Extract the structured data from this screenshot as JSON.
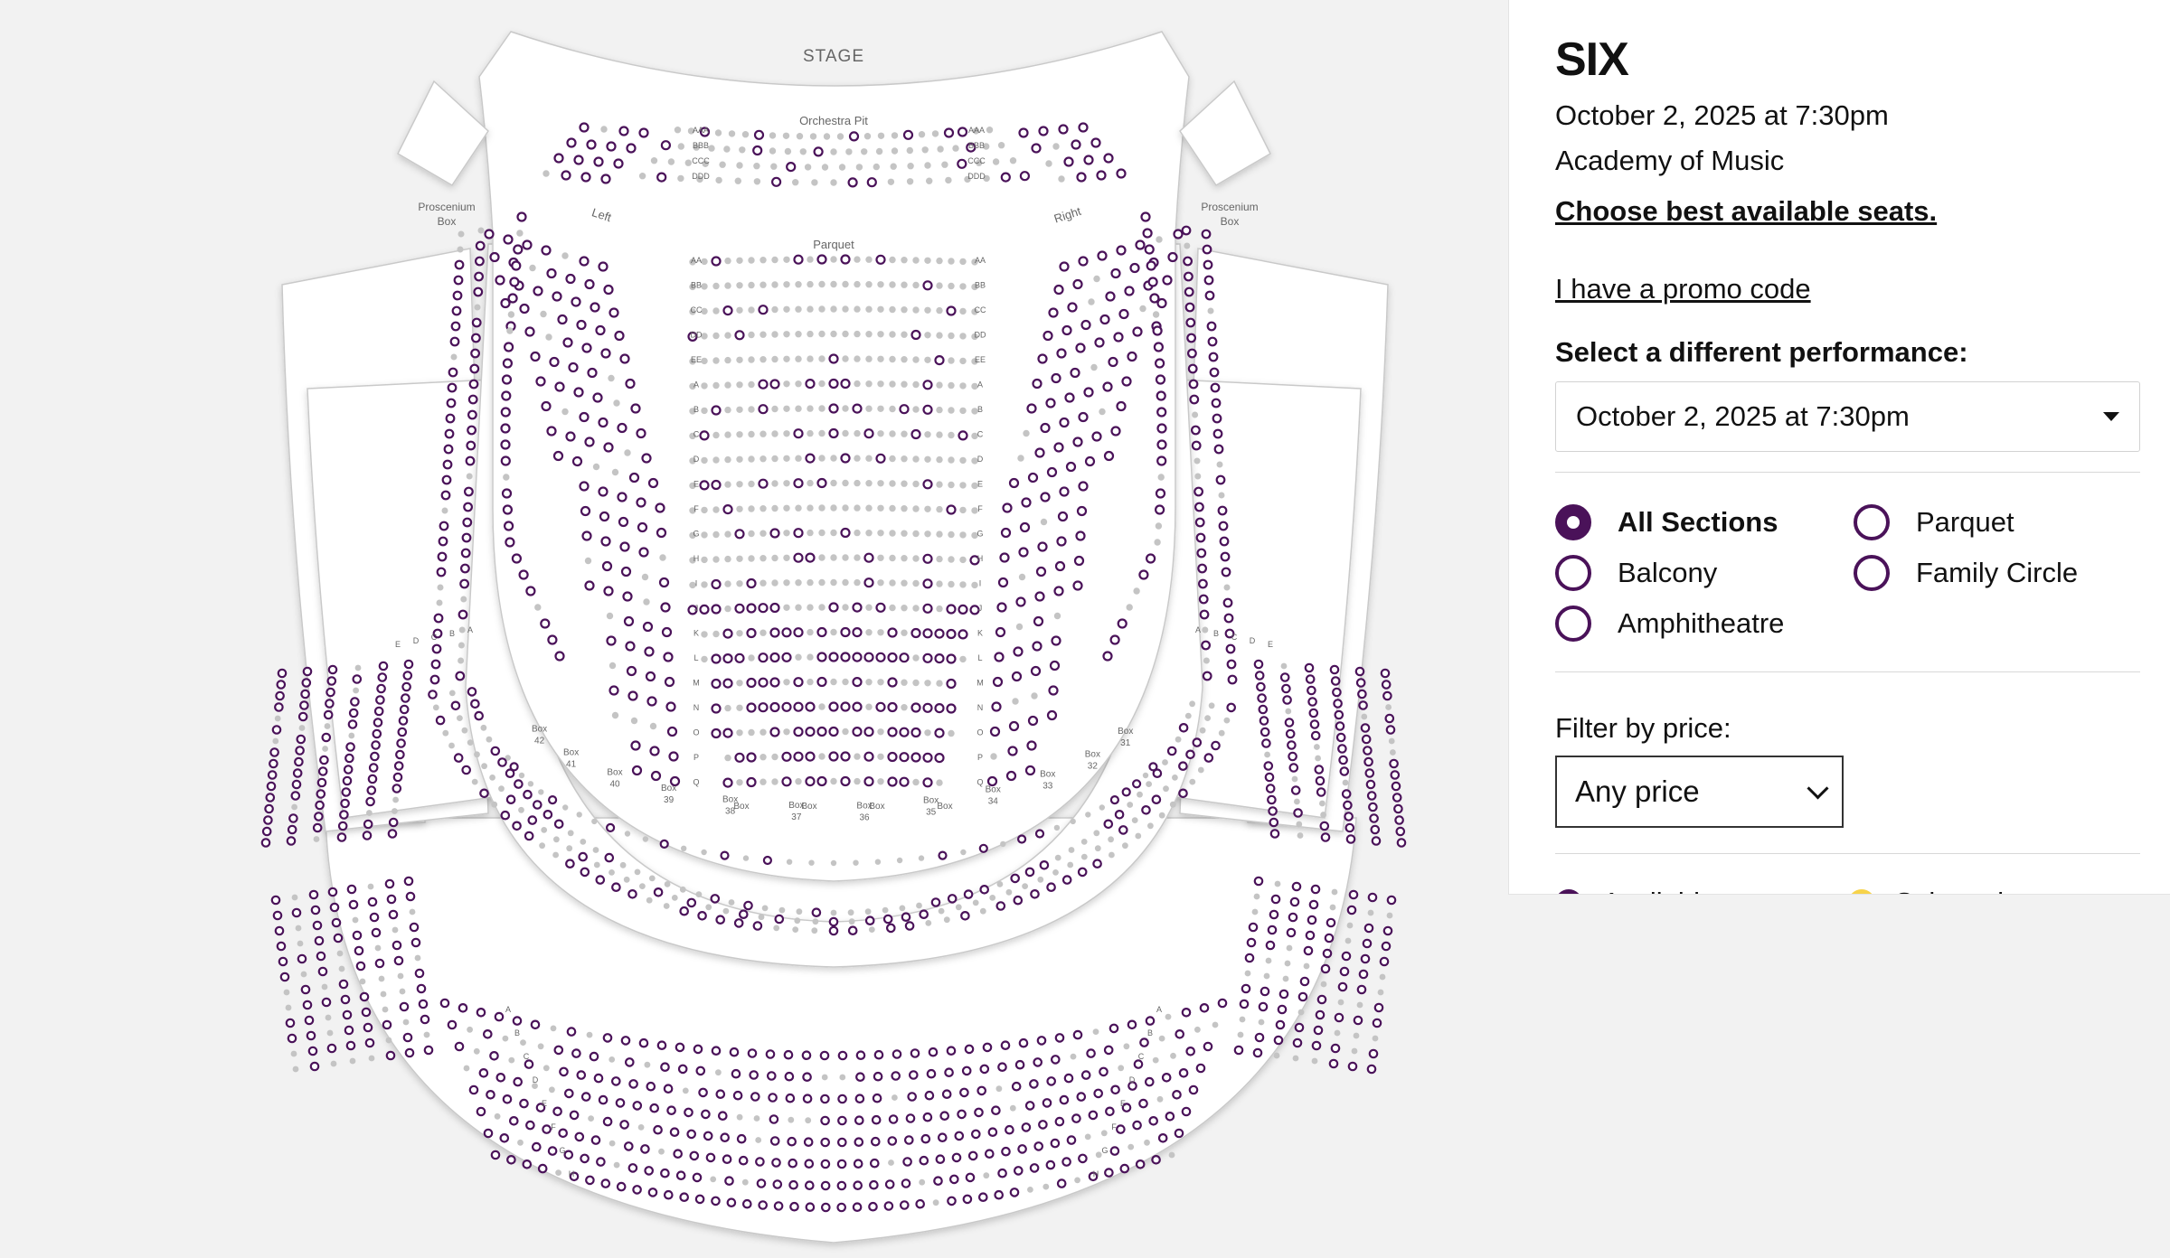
{
  "event": {
    "title": "SIX",
    "datetime": "October 2, 2025 at 7:30pm",
    "venue": "Academy of Music",
    "best_seats_link": "Choose best available seats.",
    "promo_link": "I have a promo code"
  },
  "performance": {
    "label": "Select a different performance:",
    "selected": "October 2, 2025 at 7:30pm"
  },
  "sections": {
    "options": [
      {
        "label": "All Sections",
        "checked": true
      },
      {
        "label": "Parquet",
        "checked": false
      },
      {
        "label": "Balcony",
        "checked": false
      },
      {
        "label": "Family Circle",
        "checked": false
      },
      {
        "label": "Amphitheatre",
        "checked": false
      }
    ]
  },
  "price_filter": {
    "label": "Filter by price:",
    "selected": "Any price"
  },
  "legend": {
    "available": "Available",
    "selected": "Selected"
  },
  "seatmap": {
    "stage": "STAGE",
    "orchestra_pit": "Orchestra Pit",
    "parquet": "Parquet",
    "left": "Left",
    "right": "Right",
    "proscenium_left": [
      "Proscenium",
      "Box"
    ],
    "proscenium_right": [
      "Proscenium",
      "Box"
    ],
    "pit_rows": [
      "AAA",
      "BBB",
      "CCC",
      "DDD"
    ],
    "parquet_rows": [
      "AA",
      "BB",
      "CC",
      "DD",
      "EE",
      "A",
      "B",
      "C",
      "D",
      "E",
      "F",
      "G",
      "H",
      "I",
      "J",
      "K",
      "L",
      "M",
      "N",
      "O",
      "P",
      "Q"
    ],
    "box_labels": [
      "Box 42",
      "Box 41",
      "Box 40",
      "Box 39",
      "Box 38",
      "Box 37",
      "Box 36",
      "Box 35",
      "Box 34",
      "Box 33",
      "Box 32",
      "Box 31",
      "Box",
      "Box",
      "Box",
      "Box"
    ],
    "balcony_rows": [
      "A",
      "B",
      "C",
      "D",
      "E"
    ],
    "family_rows": [
      "A",
      "B",
      "C",
      "D",
      "E",
      "F",
      "G",
      "H"
    ],
    "colors": {
      "available": "#4a1259",
      "unavailable": "#c4c4c4",
      "selected": "#f7d34a",
      "section_fill": "#ffffff",
      "outline": "#c9c9c9"
    }
  }
}
